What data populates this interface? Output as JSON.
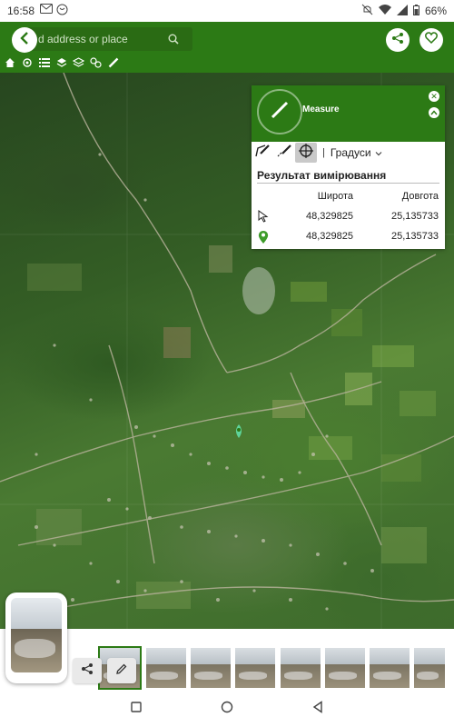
{
  "status_bar": {
    "time": "16:58",
    "battery": "66%",
    "left_icons": [
      "mail-icon",
      "chat-icon"
    ],
    "right_icons": [
      "mute-icon",
      "wifi-icon",
      "signal-icon",
      "battery-icon"
    ]
  },
  "header": {
    "search_placeholder": "Find address or place",
    "search_visible_text": "d address or place",
    "toolbar_icons": [
      "home-icon",
      "locate-icon",
      "list-icon",
      "layers-icon",
      "overlay-icon",
      "tour-icon",
      "measure-tool-icon"
    ]
  },
  "measure": {
    "title": "Measure",
    "units": "Градуси",
    "result_title": "Результат вимірювання",
    "col_lat": "Широта",
    "col_lon": "Довгота",
    "rows": [
      {
        "icon": "cursor-icon",
        "lat": "48,329825",
        "lon": "25,135733"
      },
      {
        "icon": "pin-icon",
        "lat": "48,329825",
        "lon": "25,135733"
      }
    ]
  },
  "gallery": {
    "thumb_count": 8
  },
  "colors": {
    "brand_green": "#2c7a15",
    "panel_bg": "#ffffff"
  }
}
